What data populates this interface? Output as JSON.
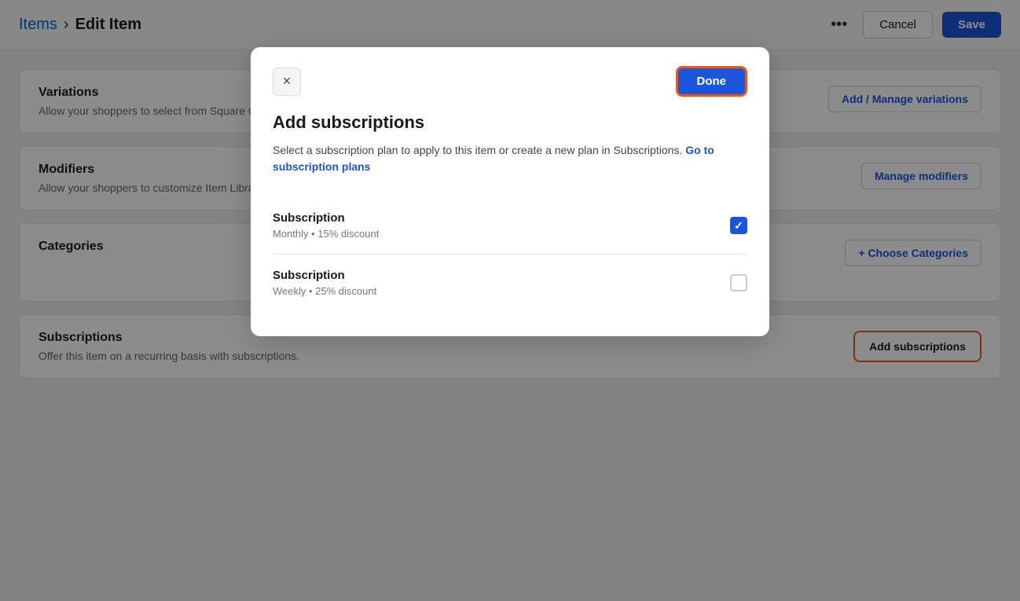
{
  "header": {
    "breadcrumb_link": "Items",
    "separator": "›",
    "page_title": "Edit Item",
    "more_icon": "•••",
    "cancel_label": "Cancel",
    "save_label": "Save"
  },
  "sections": [
    {
      "id": "variations",
      "title": "Variations",
      "description": "Allow your shoppers to select from Square Online will also update in S",
      "action_label": "Add / Manage variations"
    },
    {
      "id": "modifiers",
      "title": "Modifiers",
      "description": "Allow your shoppers to customize Item Library will also update in Sq",
      "action_label": "Manage modifiers"
    },
    {
      "id": "categories",
      "title": "Categories",
      "description": "",
      "action_label": "+ Choose Categories"
    },
    {
      "id": "subscriptions",
      "title": "Subscriptions",
      "description": "Offer this item on a recurring basis with subscriptions.",
      "action_label": "Add subscriptions"
    }
  ],
  "modal": {
    "close_icon": "×",
    "done_label": "Done",
    "title": "Add subscriptions",
    "description": "Select a subscription plan to apply to this item or create a new plan in Subscriptions.",
    "link_label": "Go to subscription plans",
    "subscriptions": [
      {
        "name": "Subscription",
        "details": "Monthly • 15% discount",
        "checked": true
      },
      {
        "name": "Subscription",
        "details": "Weekly • 25% discount",
        "checked": false
      }
    ]
  },
  "colors": {
    "accent_blue": "#1a56db",
    "accent_orange": "#e05a2b",
    "text_primary": "#1a1a1a",
    "text_secondary": "#666"
  }
}
